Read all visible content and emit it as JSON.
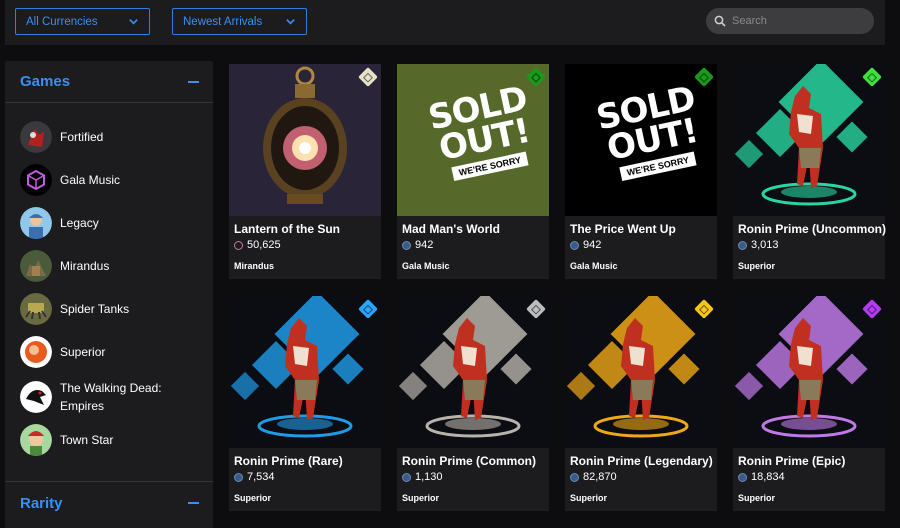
{
  "filters": {
    "currency_label": "All Currencies",
    "sort_label": "Newest Arrivals",
    "search_placeholder": "Search"
  },
  "sidebar": {
    "games_title": "Games",
    "rarity_title": "Rarity",
    "games": [
      {
        "label": "Fortified",
        "icon": "fortified-icon"
      },
      {
        "label": "Gala Music",
        "icon": "gala-music-icon"
      },
      {
        "label": "Legacy",
        "icon": "legacy-icon"
      },
      {
        "label": "Mirandus",
        "icon": "mirandus-icon"
      },
      {
        "label": "Spider Tanks",
        "icon": "spider-tanks-icon"
      },
      {
        "label": "Superior",
        "icon": "superior-icon"
      },
      {
        "label": "The Walking Dead: Empires",
        "icon": "walking-dead-icon"
      },
      {
        "label": "Town Star",
        "icon": "town-star-icon"
      }
    ]
  },
  "cards": [
    {
      "name": "Lantern of the Sun",
      "price": "50,625",
      "game": "Mirandus",
      "rarity_color": "#e8e2c8",
      "art": "lantern"
    },
    {
      "name": "Mad Man's World",
      "price": "942",
      "game": "Gala Music",
      "rarity_color": "#1a9a1a",
      "art": "sold-olive",
      "sold_text": "SOLD OUT!",
      "sold_sub": "WE'RE SORRY"
    },
    {
      "name": "The Price Went Up",
      "price": "942",
      "game": "Gala Music",
      "rarity_color": "#1a9a1a",
      "art": "sold-black",
      "sold_text": "SOLD OUT!",
      "sold_sub": "WE'RE SORRY"
    },
    {
      "name": "Ronin Prime (Uncommon)",
      "price": "3,013",
      "game": "Superior",
      "rarity_color": "#3ee03e",
      "art": "ronin",
      "glow": "#29d6a0"
    },
    {
      "name": "Ronin Prime (Rare)",
      "price": "7,534",
      "game": "Superior",
      "rarity_color": "#2ba6ff",
      "art": "ronin",
      "glow": "#1f9be8"
    },
    {
      "name": "Ronin Prime (Common)",
      "price": "1,130",
      "game": "Superior",
      "rarity_color": "#bdbdbd",
      "art": "ronin",
      "glow": "#b8b4ac"
    },
    {
      "name": "Ronin Prime (Legendary)",
      "price": "82,870",
      "game": "Superior",
      "rarity_color": "#f5c518",
      "art": "ronin",
      "glow": "#f0a818"
    },
    {
      "name": "Ronin Prime (Epic)",
      "price": "18,834",
      "game": "Superior",
      "rarity_color": "#b43cf0",
      "art": "ronin",
      "glow": "#c07ae8"
    }
  ]
}
